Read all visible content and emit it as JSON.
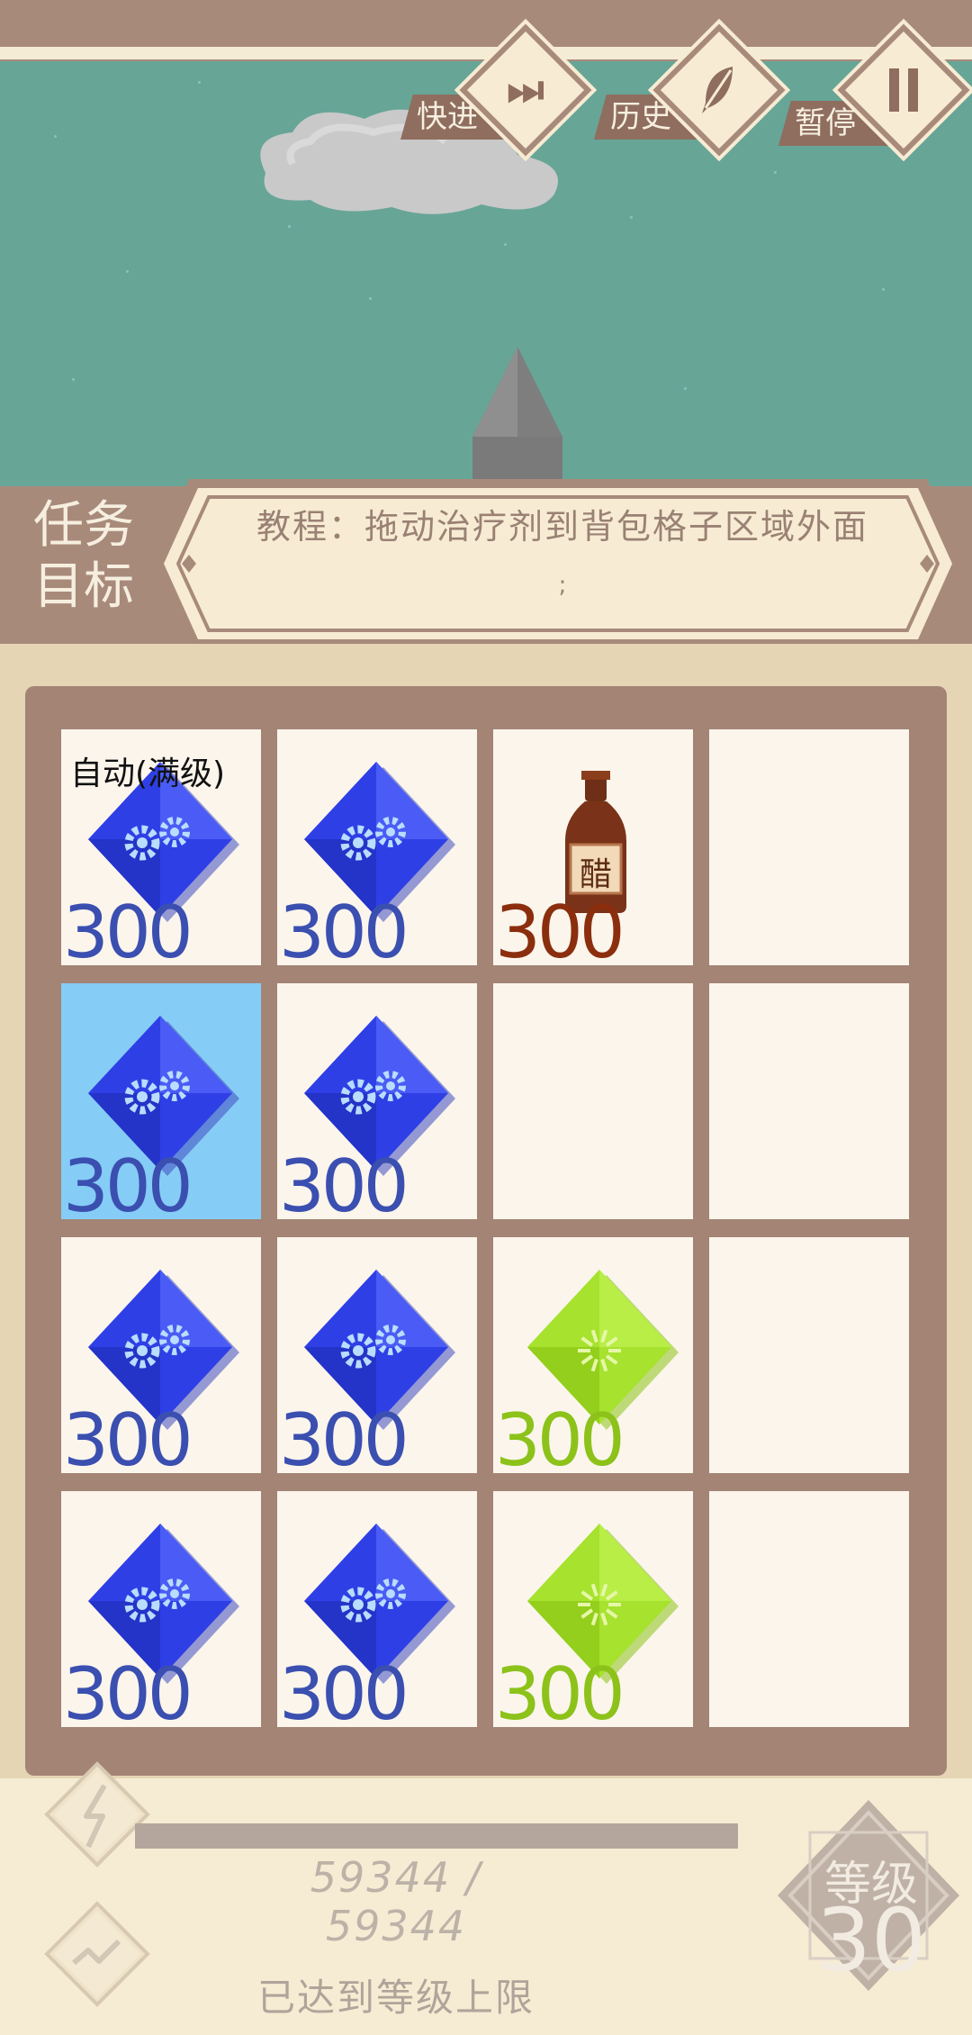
{
  "toolbar": {
    "fast_forward_label": "快进",
    "history_label": "历史",
    "pause_label": "暂停"
  },
  "task": {
    "title_line1": "任务",
    "title_line2": "目标",
    "text": "教程：拖动治疗剂到背包格子区域外面",
    "suffix": ";"
  },
  "grid": {
    "rows": 4,
    "cols": 4,
    "cells": [
      {
        "item": "gear-gem",
        "qty": "300",
        "tag": "自动(满级)",
        "selected": false
      },
      {
        "item": "gear-gem",
        "qty": "300",
        "selected": false
      },
      {
        "item": "vinegar-bottle",
        "qty": "300",
        "label": "醋",
        "selected": false
      },
      {
        "item": "empty",
        "selected": false
      },
      {
        "item": "gear-gem",
        "qty": "300",
        "selected": true
      },
      {
        "item": "gear-gem",
        "qty": "300",
        "selected": false
      },
      {
        "item": "empty",
        "selected": false
      },
      {
        "item": "empty",
        "selected": false
      },
      {
        "item": "gear-gem",
        "qty": "300",
        "selected": false
      },
      {
        "item": "gear-gem",
        "qty": "300",
        "selected": false
      },
      {
        "item": "spark-gem",
        "qty": "300",
        "selected": false
      },
      {
        "item": "empty",
        "selected": false
      },
      {
        "item": "gear-gem",
        "qty": "300",
        "selected": false
      },
      {
        "item": "gear-gem",
        "qty": "300",
        "selected": false
      },
      {
        "item": "spark-gem",
        "qty": "300",
        "selected": false
      },
      {
        "item": "empty",
        "selected": false
      }
    ]
  },
  "status": {
    "xp_text": "59344 / 59344",
    "xp_current": 59344,
    "xp_max": 59344,
    "max_level_text": "已达到等级上限",
    "level_label": "等级",
    "level_value": "30"
  },
  "colors": {
    "sky": "#67a597",
    "frame": "#a88a7b",
    "cell": "#fbf5ec",
    "selected_cell": "#85cdf6",
    "blue_gem": "#2e3fe0",
    "green_gem": "#a6e22e"
  }
}
